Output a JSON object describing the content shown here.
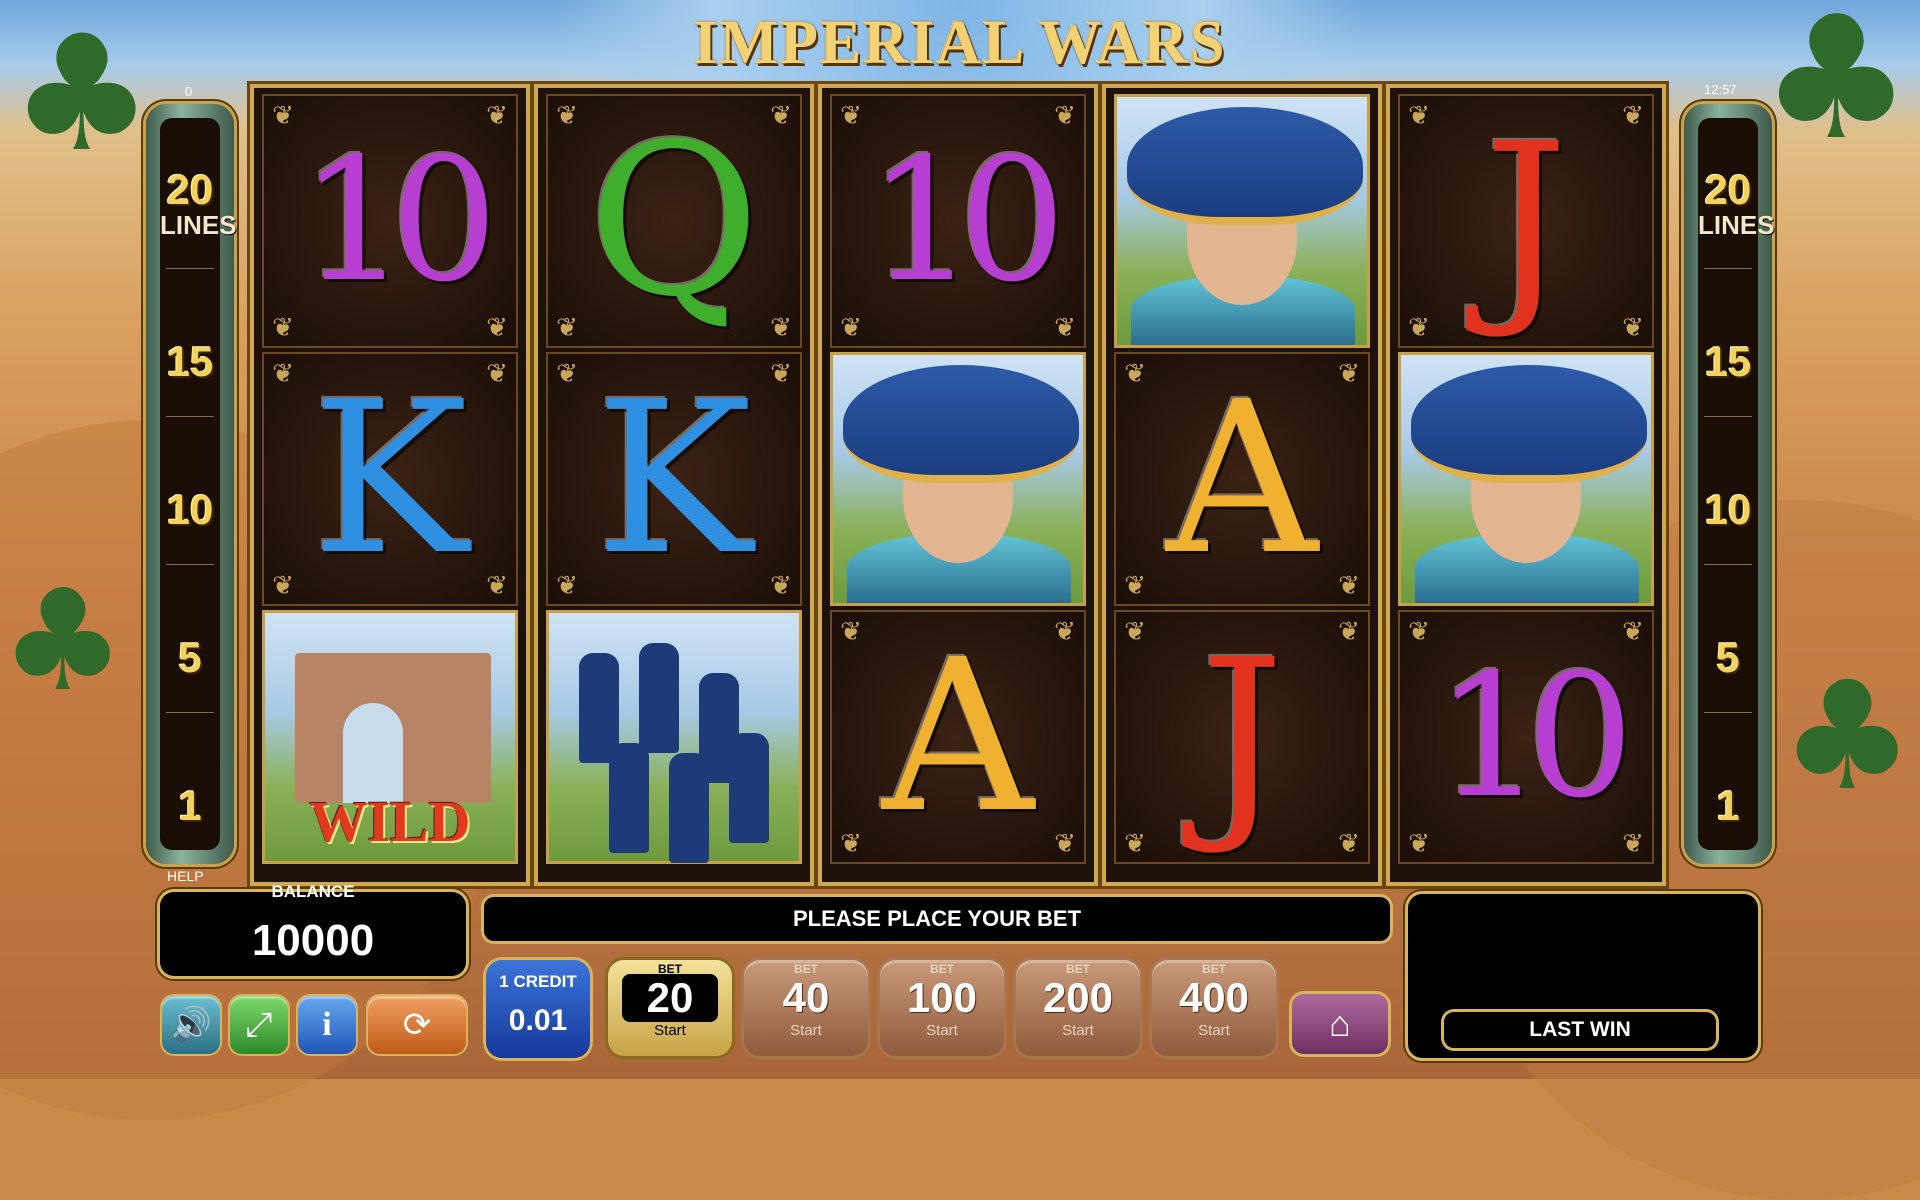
{
  "game": {
    "title": "IMPERIAL WARS"
  },
  "top_left_counter": "0",
  "clock": "12:57",
  "lines_panel": {
    "count": "20",
    "label": "LINES",
    "markers": [
      "15",
      "10",
      "5",
      "1"
    ]
  },
  "help_label": "HELP",
  "reels": [
    [
      "10",
      "K",
      "WILD"
    ],
    [
      "Q",
      "K",
      "soldiers"
    ],
    [
      "10",
      "napoleon",
      "A"
    ],
    [
      "napoleon",
      "A",
      "J"
    ],
    [
      "J",
      "napoleon",
      "10"
    ]
  ],
  "symbol_colors": {
    "10": "#b63fd1",
    "Q": "#3fae2c",
    "K": "#2f8fe0",
    "A": "#f0b030",
    "J": "#e0321d"
  },
  "wild_label": "WILD",
  "balance": {
    "label": "BALANCE",
    "value": "10000"
  },
  "message": "PLEASE PLACE YOUR BET",
  "last_win_label": "LAST WIN",
  "credit": {
    "label": "1 CREDIT",
    "value": "0.01"
  },
  "bets": [
    {
      "label": "BET",
      "value": "20",
      "sub": "Start",
      "active": true
    },
    {
      "label": "BET",
      "value": "40",
      "sub": "Start",
      "active": false
    },
    {
      "label": "BET",
      "value": "100",
      "sub": "Start",
      "active": false
    },
    {
      "label": "BET",
      "value": "200",
      "sub": "Start",
      "active": false
    },
    {
      "label": "BET",
      "value": "400",
      "sub": "Start",
      "active": false
    }
  ],
  "icons": [
    "speaker-icon",
    "fullscreen-icon",
    "info-icon",
    "autoplay-icon",
    "home-icon"
  ]
}
